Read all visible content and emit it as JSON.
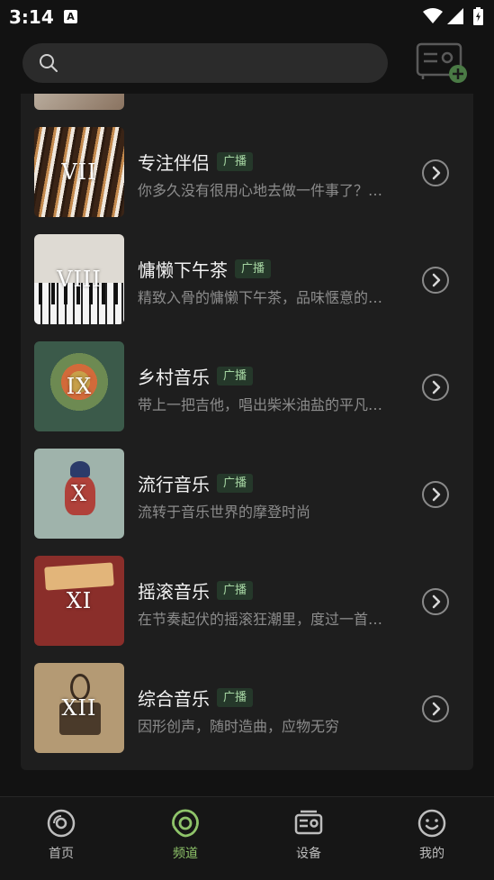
{
  "status_bar": {
    "time": "3:14",
    "notification_letter": "A"
  },
  "search": {
    "placeholder": ""
  },
  "channels": [
    {
      "numeral": "VII",
      "title": "专注伴侣",
      "badge": "广播",
      "desc": "你多久没有很用心地去做一件事了？…"
    },
    {
      "numeral": "VIII",
      "title": "慵懒下午茶",
      "badge": "广播",
      "desc": "精致入骨的慵懒下午茶，品味惬意的…"
    },
    {
      "numeral": "IX",
      "title": "乡村音乐",
      "badge": "广播",
      "desc": "带上一把吉他，唱出柴米油盐的平凡…"
    },
    {
      "numeral": "X",
      "title": "流行音乐",
      "badge": "广播",
      "desc": "流转于音乐世界的摩登时尚"
    },
    {
      "numeral": "XI",
      "title": "摇滚音乐",
      "badge": "广播",
      "desc": "在节奏起伏的摇滚狂潮里，度过一首…"
    },
    {
      "numeral": "XII",
      "title": "综合音乐",
      "badge": "广播",
      "desc": "因形创声，随时造曲，应物无穷"
    }
  ],
  "thumb_colors": [
    "#6b4a2a",
    "#d9d4cc",
    "#3b5a4a",
    "#9fb3ab",
    "#8a2e2a",
    "#b49a74"
  ],
  "bottom_nav": [
    {
      "label": "首页",
      "icon": "disc-icon",
      "active": false
    },
    {
      "label": "频道",
      "icon": "channel-icon",
      "active": true
    },
    {
      "label": "设备",
      "icon": "radio-device-icon",
      "active": false
    },
    {
      "label": "我的",
      "icon": "smiley-icon",
      "active": false
    }
  ],
  "colors": {
    "accent": "#8fc46a",
    "badge_bg": "#25382a",
    "badge_text": "#a6d6a3",
    "panel": "#1e1e1e",
    "background": "#121212"
  }
}
